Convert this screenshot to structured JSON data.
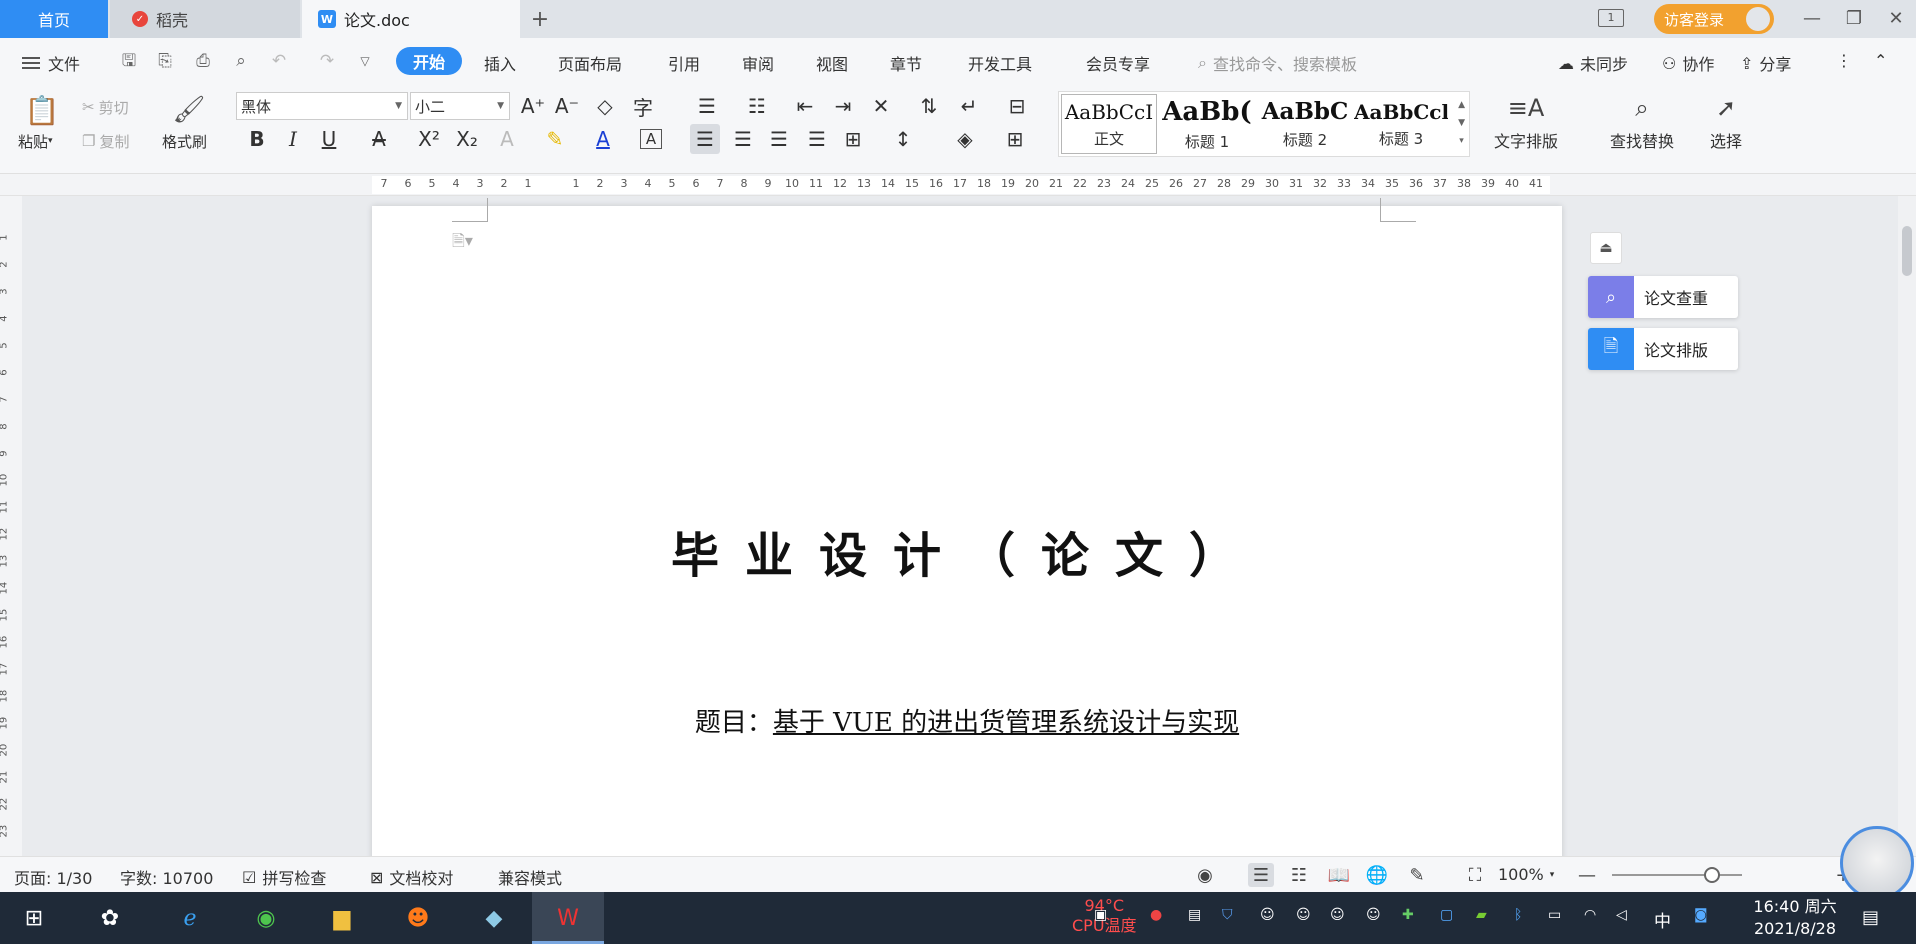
{
  "tabs": {
    "home": "首页",
    "daoke": "稻壳",
    "doc": "论文.doc"
  },
  "titlebar": {
    "login": "访客登录"
  },
  "menu": {
    "file": "文件",
    "items": [
      "开始",
      "插入",
      "页面布局",
      "引用",
      "审阅",
      "视图",
      "章节",
      "开发工具",
      "会员专享"
    ],
    "search_placeholder": "查找命令、搜索模板",
    "sync": "未同步",
    "collab": "协作",
    "share": "分享"
  },
  "ribbon": {
    "paste": "粘贴",
    "cut": "剪切",
    "copy": "复制",
    "format_painter": "格式刷",
    "font_name": "黑体",
    "font_size": "小二",
    "styles": [
      {
        "sample": "AaBbCcI",
        "name": "正文"
      },
      {
        "sample": "AaBb(",
        "name": "标题 1"
      },
      {
        "sample": "AaBbC",
        "name": "标题 2"
      },
      {
        "sample": "AaBbCcl",
        "name": "标题 3"
      }
    ],
    "text_layout": "文字排版",
    "find_replace": "查找替换",
    "select": "选择"
  },
  "ruler": {
    "h_numbers": [
      "7",
      "6",
      "5",
      "4",
      "3",
      "2",
      "1",
      "",
      "1",
      "2",
      "3",
      "4",
      "5",
      "6",
      "7",
      "8",
      "9",
      "10",
      "11",
      "12",
      "13",
      "14",
      "15",
      "16",
      "17",
      "18",
      "19",
      "20",
      "21",
      "22",
      "23",
      "24",
      "25",
      "26",
      "27",
      "28",
      "29",
      "30",
      "31",
      "32",
      "33",
      "34",
      "35",
      "36",
      "37",
      "38",
      "39",
      "40",
      "41"
    ],
    "v_numbers": [
      "1",
      "2",
      "3",
      "4",
      "5",
      "6",
      "7",
      "8",
      "9",
      "10",
      "11",
      "12",
      "13",
      "14",
      "15",
      "16",
      "17",
      "18",
      "19",
      "20",
      "21",
      "22",
      "23"
    ]
  },
  "document": {
    "title": "毕业设计（论文）",
    "subject_label": "题目：",
    "subject_value": "基于 VUE 的进出货管理系统设计与实现"
  },
  "side_panel": {
    "check": "论文查重",
    "layout": "论文排版"
  },
  "status": {
    "page": "页面: 1/30",
    "words": "字数: 10700",
    "spell": "拼写检查",
    "proof": "文档校对",
    "compat": "兼容模式",
    "zoom": "100%"
  },
  "taskbar": {
    "cpu_temp": "94°C",
    "cpu_label": "CPU温度",
    "ime": "中",
    "time": "16:40 周六",
    "date": "2021/8/28"
  },
  "colors": {
    "accent": "#2f8df3",
    "login": "#f2a12f",
    "taskbar": "#1f2a38"
  }
}
